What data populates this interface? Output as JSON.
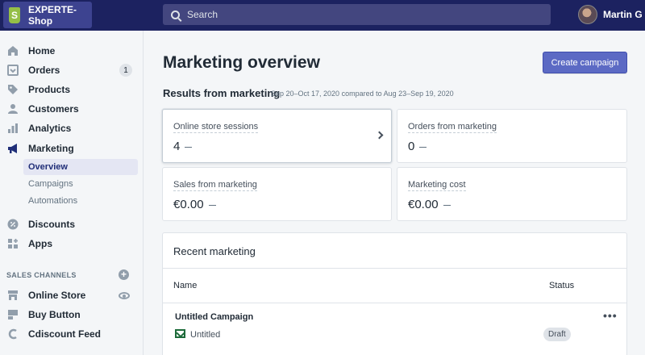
{
  "topbar": {
    "store_name": "EXPERTE-Shop",
    "logo_letter": "S",
    "search_placeholder": "Search",
    "user_name": "Martin G"
  },
  "sidebar": {
    "items": [
      {
        "label": "Home",
        "icon": "home-icon"
      },
      {
        "label": "Orders",
        "icon": "orders-icon",
        "badge": "1"
      },
      {
        "label": "Products",
        "icon": "tag-icon"
      },
      {
        "label": "Customers",
        "icon": "person-icon"
      },
      {
        "label": "Analytics",
        "icon": "bar-chart-icon"
      },
      {
        "label": "Marketing",
        "icon": "megaphone-icon"
      }
    ],
    "marketing_sub": [
      {
        "label": "Overview",
        "active": true
      },
      {
        "label": "Campaigns"
      },
      {
        "label": "Automations"
      }
    ],
    "items_after": [
      {
        "label": "Discounts",
        "icon": "discount-icon"
      },
      {
        "label": "Apps",
        "icon": "apps-icon"
      }
    ],
    "channels_title": "SALES CHANNELS",
    "channels": [
      {
        "label": "Online Store",
        "icon": "store-icon"
      },
      {
        "label": "Buy Button",
        "icon": "buy-button-icon"
      },
      {
        "label": "Cdiscount Feed",
        "icon": "cdiscount-icon"
      }
    ]
  },
  "main": {
    "title": "Marketing overview",
    "create_button": "Create campaign",
    "results_title": "Results from marketing",
    "results_range": "Sep 20–Oct 17, 2020 compared to Aug 23–Sep 19, 2020",
    "metrics": [
      {
        "label": "Online store sessions",
        "value": "4"
      },
      {
        "label": "Orders from marketing",
        "value": "0"
      },
      {
        "label": "Sales from marketing",
        "value": "€0.00"
      },
      {
        "label": "Marketing cost",
        "value": "€0.00"
      }
    ],
    "recent": {
      "title": "Recent marketing",
      "columns": [
        "Name",
        "Status"
      ],
      "rows": [
        {
          "title": "Untitled Campaign",
          "activity": "Untitled",
          "status": "Draft",
          "more": "•••"
        }
      ]
    }
  },
  "colors": {
    "topbar": "#1c2260",
    "accent": "#5c6ac4",
    "shopify_green": "#95bf47"
  }
}
